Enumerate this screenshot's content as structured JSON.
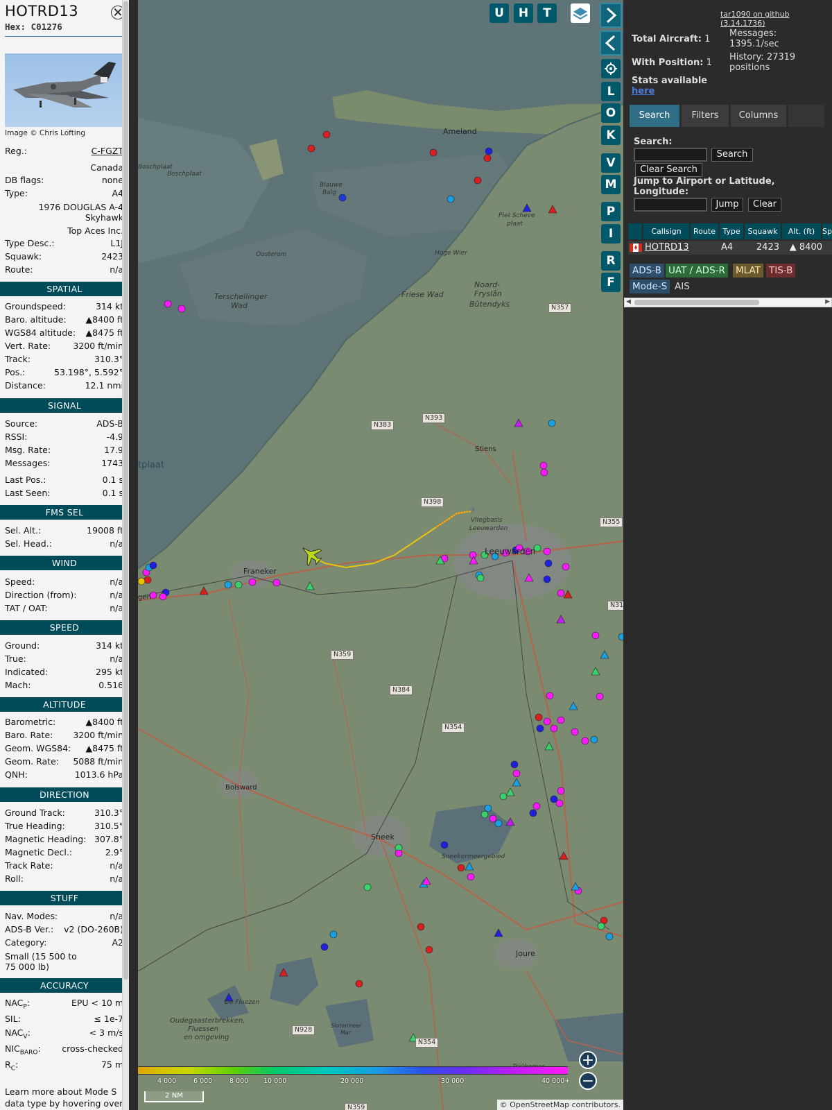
{
  "info": {
    "callsign": "HOTRD13",
    "hex": "Hex: C01276",
    "image_credit": "Image © Chris Lofting",
    "reg_label": "Reg.:",
    "reg": "C-FGZT",
    "country": "Canada",
    "dbflags_label": "DB flags:",
    "dbflags": "none",
    "type_label": "Type:",
    "type": "A4",
    "model_line1": "1976 DOUGLAS A-4",
    "model_line2": "Skyhawk",
    "operator": "Top Aces Inc.",
    "typedesc_label": "Type Desc.:",
    "typedesc": "L1J",
    "squawk_label": "Squawk:",
    "squawk": "2423",
    "route_label": "Route:",
    "route": "n/a",
    "sections": {
      "spatial": "SPATIAL",
      "signal": "SIGNAL",
      "fms": "FMS SEL",
      "wind": "WIND",
      "speed": "SPEED",
      "altitude": "ALTITUDE",
      "direction": "DIRECTION",
      "stuff": "STUFF",
      "accuracy": "ACCURACY"
    },
    "spatial": [
      [
        "Groundspeed:",
        "314 kt"
      ],
      [
        "Baro. altitude:",
        "▲8400 ft"
      ],
      [
        "WGS84 altitude:",
        "▲8475 ft"
      ],
      [
        "Vert. Rate:",
        "3200 ft/min"
      ],
      [
        "Track:",
        "310.3°"
      ],
      [
        "Pos.:",
        "53.198°, 5.592°"
      ],
      [
        "Distance:",
        "12.1 nmi"
      ]
    ],
    "signal": [
      [
        "Source:",
        "ADS-B"
      ],
      [
        "RSSI:",
        "-4.9"
      ],
      [
        "Msg. Rate:",
        "17.9"
      ],
      [
        "Messages:",
        "1743"
      ],
      [
        "Last Pos.:",
        "0.1 s"
      ],
      [
        "Last Seen:",
        "0.1 s"
      ]
    ],
    "fms": [
      [
        "Sel. Alt.:",
        "19008 ft"
      ],
      [
        "Sel. Head.:",
        "n/a"
      ]
    ],
    "wind": [
      [
        "Speed:",
        "n/a"
      ],
      [
        "Direction (from):",
        "n/a"
      ],
      [
        "TAT / OAT:",
        "n/a"
      ]
    ],
    "speed": [
      [
        "Ground:",
        "314 kt"
      ],
      [
        "True:",
        "n/a"
      ],
      [
        "Indicated:",
        "295 kt"
      ],
      [
        "Mach:",
        "0.516"
      ]
    ],
    "altitude": [
      [
        "Barometric:",
        "▲8400 ft"
      ],
      [
        "Baro. Rate:",
        "3200 ft/min"
      ],
      [
        "Geom. WGS84:",
        "▲8475 ft"
      ],
      [
        "Geom. Rate:",
        "5088 ft/min"
      ],
      [
        "QNH:",
        "1013.6 hPa"
      ]
    ],
    "direction": [
      [
        "Ground Track:",
        "310.3°"
      ],
      [
        "True Heading:",
        "310.5°"
      ],
      [
        "Magnetic Heading:",
        "307.8°"
      ],
      [
        "Magnetic Decl.:",
        "2.9°"
      ],
      [
        "Track Rate:",
        "n/a"
      ],
      [
        "Roll:",
        "n/a"
      ]
    ],
    "stuff": [
      [
        "Nav. Modes:",
        "n/a"
      ],
      [
        "ADS-B Ver.:",
        "v2 (DO-260B)"
      ],
      [
        "Category:",
        "A2"
      ]
    ],
    "category_desc1": "Small (15 500 to",
    "category_desc2": "75 000 lb)",
    "accuracy": {
      "nacp_label": "NAC",
      "nacp_sub": "P",
      "nacp": "EPU < 10 m",
      "sil_label": "SIL:",
      "sil": "≤ 1e-7",
      "nacv_label": "NAC",
      "nacv_sub": "V",
      "nacv": "< 3 m/s",
      "nicbaro_label": "NIC",
      "nicbaro_sub": "BARO",
      "nicbaro": "cross-checked",
      "rc_label": "R",
      "rc_sub": "C",
      "rc": "75 m"
    },
    "footer1": "Learn more about Mode S",
    "footer2": "data type by hovering over"
  },
  "map": {
    "buttons_top": [
      "U",
      "H",
      "T"
    ],
    "side_buttons": [
      "L",
      "O",
      "K",
      "V",
      "M",
      "P",
      "I",
      "R",
      "F"
    ],
    "labels": {
      "ameland": "Ameland",
      "boschplaat1": "Boschplaat",
      "boschplaat2": "Boschplaat",
      "blauwe": "Blauwe",
      "balg": "Balg",
      "oosterom": "Oosterom",
      "terschellinger": "Terschellinger",
      "wad1": "Wad",
      "friese": "Friese Wad",
      "hogewier": "Hoge Wier",
      "pietscheve": "Piet Scheve",
      "plaat": "plaat",
      "noardfryslan1": "Noard-",
      "noardfryslan2": "Fryslân",
      "noardfryslan3": "Bûtendyks",
      "stiens": "Stiens",
      "vliegbasis": "Vliegbasis",
      "leeuwarden_ab": "Leeuwarden",
      "leeuwarden": "Leeuwarden",
      "franeker": "Franeker",
      "bolsward": "Bolsward",
      "sneek": "Sneek",
      "sneekermeer": "Sneekermeergebied",
      "joure": "Joure",
      "oudega1": "Oudegaasterbrekken,",
      "oudega2": "Fluessen",
      "oudega3": "en omgeving",
      "slotermeer1": "Slotermeer",
      "slotermeer2": "Mar",
      "fluezen": "De Fluezen",
      "tsjeukemar": "Tsjûkemar",
      "plaat_left": "tplaat",
      "genemuiden": "gen"
    },
    "roads": [
      "N357",
      "N393",
      "N383",
      "N398",
      "N355",
      "N359",
      "N384",
      "N354",
      "N31",
      "N928",
      "N354",
      "N359"
    ],
    "colorbar_labels": [
      "4 000",
      "6 000",
      "8 000",
      "10 000",
      "20 000",
      "30 000",
      "40 000+"
    ],
    "scale": "2 NM",
    "attribution": "© OpenStreetMap contributors."
  },
  "right": {
    "github_link": "tar1090 on github (3.14.1736)",
    "total_aircraft_label": "Total Aircraft:",
    "total_aircraft": "1",
    "with_position_label": "With Position:",
    "with_position": "1",
    "messages_label": "Messages:",
    "messages": "1395.1/sec",
    "history_label": "History:",
    "history": "27319",
    "history_unit": "positions",
    "stats_label": "Stats available",
    "stats_link": "here",
    "tabs": [
      "Search",
      "Filters",
      "Columns"
    ],
    "search_label": "Search:",
    "search_button": "Search",
    "clear_search_button": "Clear Search",
    "jump_label1": "Jump to Airport or Latitude,",
    "jump_label2": "Longitude:",
    "jump_button": "Jump",
    "clear_button": "Clear",
    "table_headers": [
      "Callsign",
      "Route",
      "Type",
      "Squawk",
      "Alt. (ft)",
      "Sp"
    ],
    "table_row": {
      "callsign": "HOTRD13",
      "route": "",
      "type": "A4",
      "squawk": "2423",
      "alt": "▲ 8400"
    },
    "legend": [
      "ADS-B",
      "UAT / ADS-R",
      "MLAT",
      "TIS-B",
      "Mode-S",
      "AIS"
    ],
    "colors": {
      "adsb": "#2e4d6b",
      "uat": "#2d6b3b",
      "mlat": "#6b5a2d",
      "tisb": "#6b2d2d",
      "modes": "#2e4d6b",
      "header": "#004b5a"
    }
  }
}
